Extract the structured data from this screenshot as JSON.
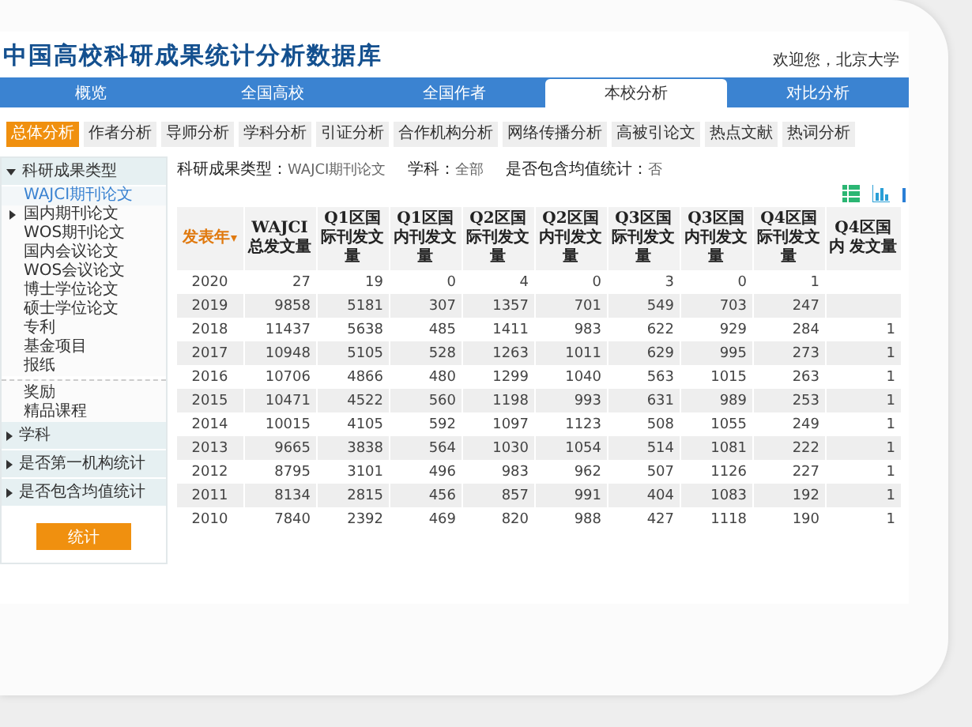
{
  "header": {
    "title": "中国高校科研成果统计分析数据库",
    "welcome": "欢迎您，北京大学"
  },
  "nav_tabs": [
    {
      "label": "概览",
      "selected": false
    },
    {
      "label": "全国高校",
      "selected": false
    },
    {
      "label": "全国作者",
      "selected": false
    },
    {
      "label": "本校分析",
      "selected": true
    },
    {
      "label": "对比分析",
      "selected": false
    }
  ],
  "sub_tabs": [
    {
      "label": "总体分析",
      "selected": true
    },
    {
      "label": "作者分析",
      "selected": false
    },
    {
      "label": "导师分析",
      "selected": false
    },
    {
      "label": "学科分析",
      "selected": false
    },
    {
      "label": "引证分析",
      "selected": false
    },
    {
      "label": "合作机构分析",
      "selected": false
    },
    {
      "label": "网络传播分析",
      "selected": false
    },
    {
      "label": "高被引论文",
      "selected": false
    },
    {
      "label": "热点文献",
      "selected": false
    },
    {
      "label": "热词分析",
      "selected": false
    }
  ],
  "sidebar": {
    "sections": [
      {
        "label": "科研成果类型",
        "expanded": true,
        "children": [
          {
            "label": "WAJCI期刊论文",
            "selected": true,
            "has_children": false,
            "separator_before": false
          },
          {
            "label": "国内期刊论文",
            "selected": false,
            "has_children": true,
            "separator_before": false
          },
          {
            "label": "WOS期刊论文",
            "selected": false,
            "has_children": false,
            "separator_before": false
          },
          {
            "label": "国内会议论文",
            "selected": false,
            "has_children": false,
            "separator_before": false
          },
          {
            "label": "WOS会议论文",
            "selected": false,
            "has_children": false,
            "separator_before": false
          },
          {
            "label": "博士学位论文",
            "selected": false,
            "has_children": false,
            "separator_before": false
          },
          {
            "label": "硕士学位论文",
            "selected": false,
            "has_children": false,
            "separator_before": false
          },
          {
            "label": "专利",
            "selected": false,
            "has_children": false,
            "separator_before": false
          },
          {
            "label": "基金项目",
            "selected": false,
            "has_children": false,
            "separator_before": false
          },
          {
            "label": "报纸",
            "selected": false,
            "has_children": false,
            "separator_before": false
          },
          {
            "label": "奖励",
            "selected": false,
            "has_children": false,
            "separator_before": true
          },
          {
            "label": "精品课程",
            "selected": false,
            "has_children": false,
            "separator_before": false
          }
        ]
      },
      {
        "label": "学科",
        "expanded": false
      },
      {
        "label": "是否第一机构统计",
        "expanded": false
      },
      {
        "label": "是否包含均值统计",
        "expanded": false
      }
    ],
    "button": "统计"
  },
  "filters": [
    {
      "label": "科研成果类型：",
      "value": "WAJCI期刊论文"
    },
    {
      "label": "学科：",
      "value": "全部"
    },
    {
      "label": "是否包含均值统计：",
      "value": "否"
    }
  ],
  "table": {
    "columns": [
      {
        "label": "发表年",
        "sorted": true
      },
      {
        "label": "WAJCI总发文量",
        "sorted": false
      },
      {
        "label": "Q1区国际刊发文量",
        "sorted": false
      },
      {
        "label": "Q1区国内刊发文量",
        "sorted": false
      },
      {
        "label": "Q2区国际刊发文量",
        "sorted": false
      },
      {
        "label": "Q2区国内刊发文量",
        "sorted": false
      },
      {
        "label": "Q3区国际刊发文量",
        "sorted": false
      },
      {
        "label": "Q3区国内刊发文量",
        "sorted": false
      },
      {
        "label": "Q4区国际刊发文量",
        "sorted": false
      },
      {
        "label": "Q4区国内 发文量",
        "sorted": false
      }
    ],
    "rows": [
      [
        "2020",
        "27",
        "19",
        "0",
        "4",
        "0",
        "3",
        "0",
        "1",
        ""
      ],
      [
        "2019",
        "9858",
        "5181",
        "307",
        "1357",
        "701",
        "549",
        "703",
        "247",
        ""
      ],
      [
        "2018",
        "11437",
        "5638",
        "485",
        "1411",
        "983",
        "622",
        "929",
        "284",
        "1"
      ],
      [
        "2017",
        "10948",
        "5105",
        "528",
        "1263",
        "1011",
        "629",
        "995",
        "273",
        "1"
      ],
      [
        "2016",
        "10706",
        "4866",
        "480",
        "1299",
        "1040",
        "563",
        "1015",
        "263",
        "1"
      ],
      [
        "2015",
        "10471",
        "4522",
        "560",
        "1198",
        "993",
        "631",
        "989",
        "253",
        "1"
      ],
      [
        "2014",
        "10015",
        "4105",
        "592",
        "1097",
        "1123",
        "508",
        "1055",
        "249",
        "1"
      ],
      [
        "2013",
        "9665",
        "3838",
        "564",
        "1030",
        "1054",
        "514",
        "1081",
        "222",
        "1"
      ],
      [
        "2012",
        "8795",
        "3101",
        "496",
        "983",
        "962",
        "507",
        "1126",
        "227",
        "1"
      ],
      [
        "2011",
        "8134",
        "2815",
        "456",
        "857",
        "991",
        "404",
        "1083",
        "192",
        "1"
      ],
      [
        "2010",
        "7840",
        "2392",
        "469",
        "820",
        "988",
        "427",
        "1118",
        "190",
        "1"
      ]
    ]
  }
}
